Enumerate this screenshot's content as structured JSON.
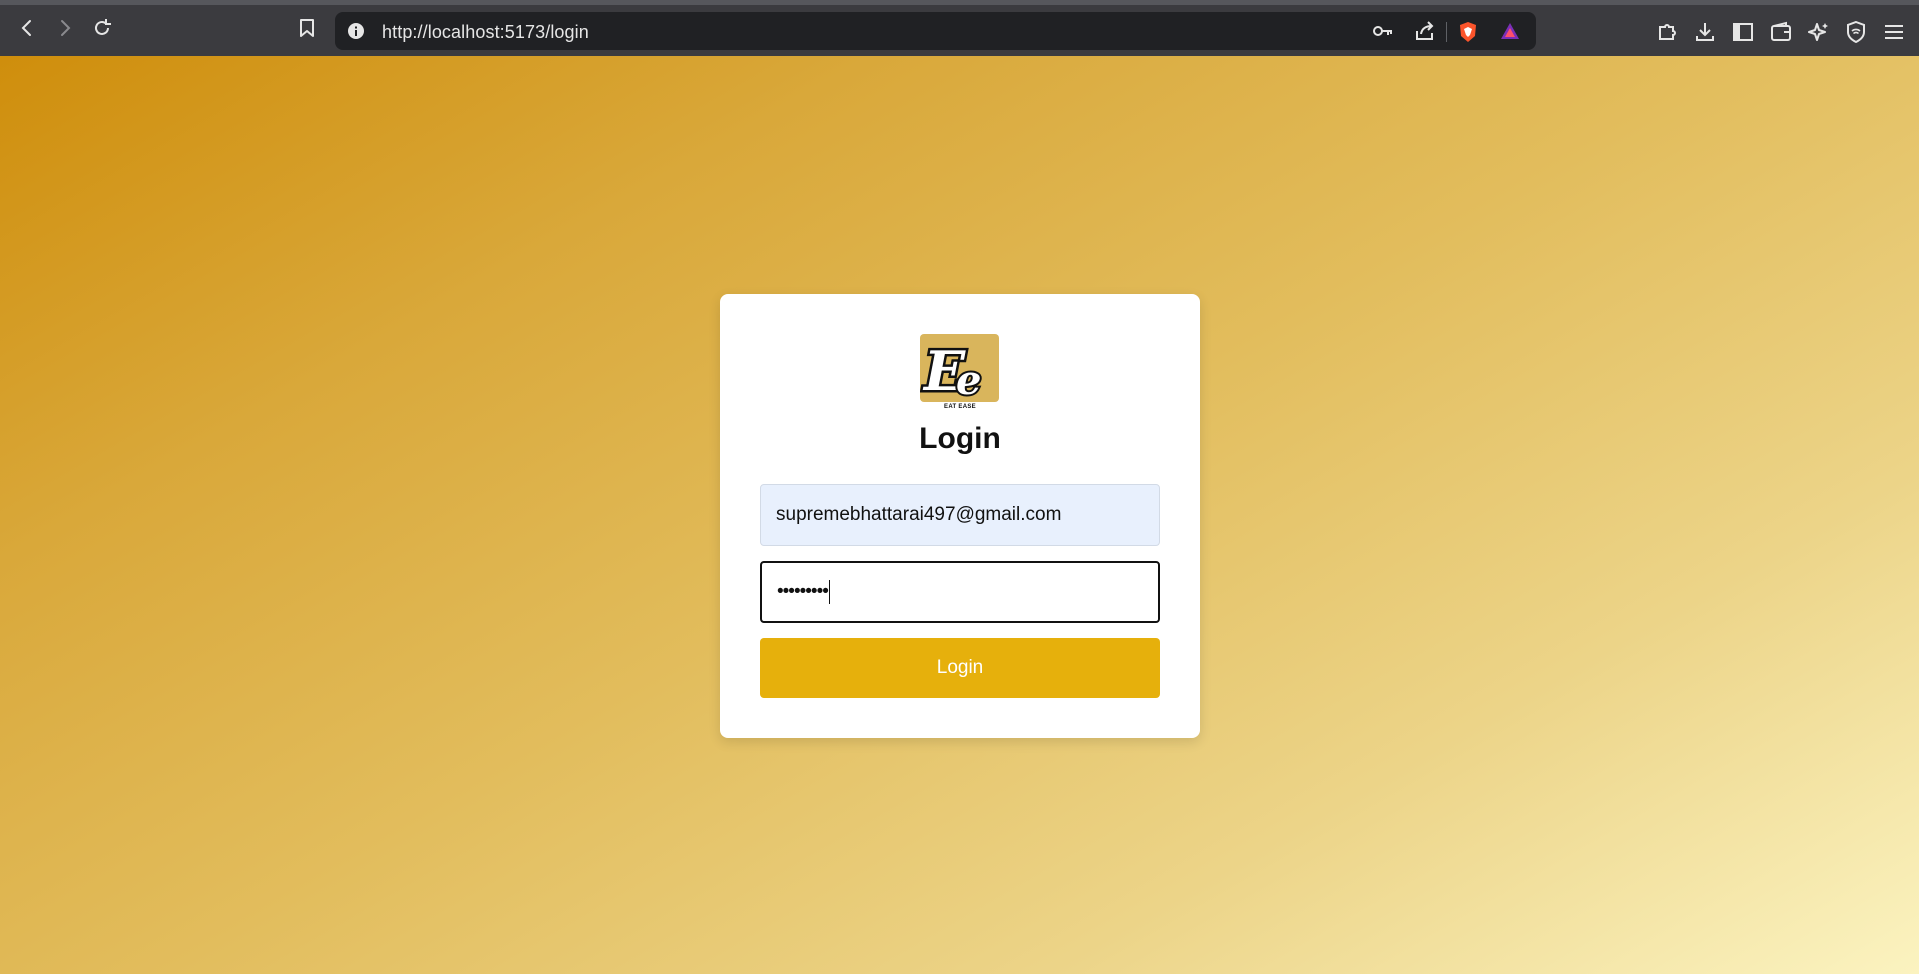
{
  "browser": {
    "url": "http://localhost:5173/login"
  },
  "login": {
    "logo_caption": "EAT EASE",
    "title": "Login",
    "email_value": "supremebhattarai497@gmail.com",
    "password_mask": "•••••••••",
    "button_label": "Login"
  },
  "colors": {
    "button": "#e6b00c",
    "logo_bg": "#d9b55c",
    "email_bg": "#e8f0fd"
  }
}
